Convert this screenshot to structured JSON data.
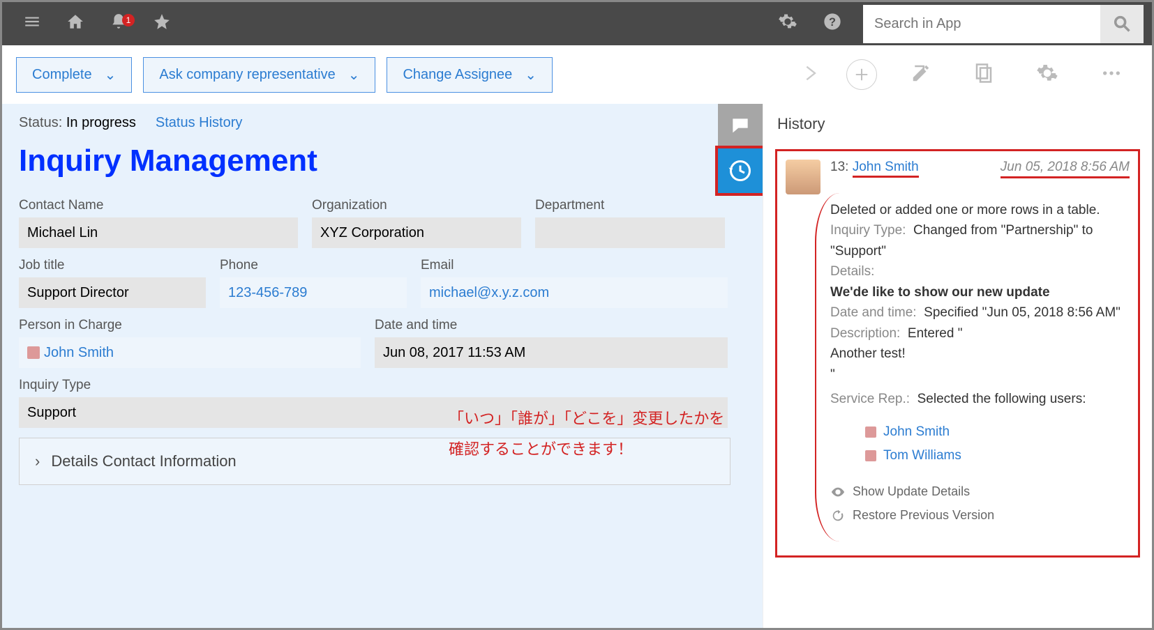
{
  "topbar": {
    "search_placeholder": "Search in App",
    "notification_count": "1"
  },
  "actionbar": {
    "complete": "Complete",
    "ask_rep": "Ask company representative",
    "change_assignee": "Change Assignee"
  },
  "status": {
    "label": "Status:",
    "value": "In progress",
    "history_link": "Status History"
  },
  "page_title": "Inquiry Management",
  "fields": {
    "contact_name": {
      "label": "Contact Name",
      "value": "Michael Lin"
    },
    "organization": {
      "label": "Organization",
      "value": "XYZ Corporation"
    },
    "department": {
      "label": "Department",
      "value": ""
    },
    "job_title": {
      "label": "Job title",
      "value": "Support Director"
    },
    "phone": {
      "label": "Phone",
      "value": "123-456-789"
    },
    "email": {
      "label": "Email",
      "value": "michael@x.y.z.com"
    },
    "person_in_charge": {
      "label": "Person in Charge",
      "value": "John Smith"
    },
    "date_time": {
      "label": "Date and time",
      "value": "Jun 08, 2017 11:53 AM"
    },
    "inquiry_type": {
      "label": "Inquiry Type",
      "value": "Support"
    }
  },
  "accordion": {
    "label": "Details Contact Information"
  },
  "callout": {
    "line1": "「いつ」「誰が」「どこを」変更したかを",
    "line2": "確認することができます！"
  },
  "history": {
    "title": "History",
    "entry": {
      "num": "13:",
      "user": "John Smith",
      "timestamp": "Jun 05, 2018 8:56 AM",
      "summary": "Deleted or added one or more rows in a table.",
      "inquiry_type_label": "Inquiry Type:",
      "inquiry_type_change": "Changed from \"Partnership\" to \"Support\"",
      "details_label": "Details:",
      "details_value": "We'de like to show our new update",
      "datetime_label": "Date and time:",
      "datetime_value": "Specified \"Jun 05, 2018 8:56 AM\"",
      "description_label": "Description:",
      "description_value": "Entered \"",
      "description_line2": "Another test!",
      "description_line3": "\"",
      "service_rep_label": "Service Rep.:",
      "service_rep_value": "Selected the following users:",
      "users": [
        "John Smith",
        "Tom Williams"
      ]
    },
    "show_details": "Show Update Details",
    "restore": "Restore Previous Version"
  }
}
